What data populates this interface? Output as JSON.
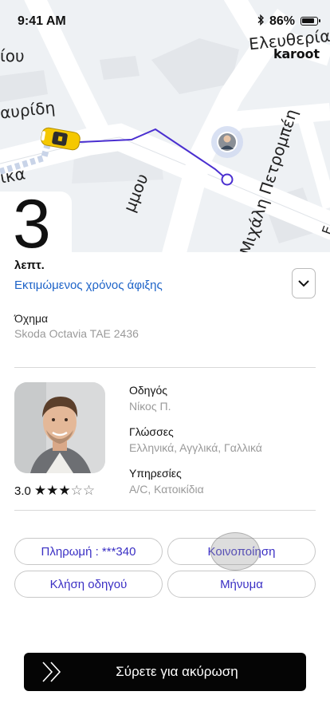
{
  "status_bar": {
    "time": "9:41 AM",
    "battery_percent": "86%",
    "battery_level": 0.86
  },
  "map": {
    "brand": "karoot",
    "streets": [
      "Ελευθερία",
      "ίου",
      "αυρίδη",
      "ικα",
      "μμου",
      "Μιχάλη Πετρομπέη",
      "Ε"
    ]
  },
  "eta": {
    "minutes": "3",
    "unit": "λεπτ.",
    "label": "Εκτιμώμενος χρόνος άφιξης"
  },
  "vehicle": {
    "title": "Όχημα",
    "value": "Skoda Octavia TAE 2436"
  },
  "driver": {
    "rating": "3.0",
    "rating_value": 3,
    "rating_max": 5,
    "driver_title": "Οδηγός",
    "driver_name": "Νίκος Π.",
    "languages_title": "Γλώσσες",
    "languages": "Ελληνικά, Αγγλικά, Γαλλικά",
    "services_title": "Υπηρεσίες",
    "services": "A/C, Κατοικίδια"
  },
  "actions": {
    "payment": "Πληρωμή : ***340",
    "share": "Κοινοποίηση",
    "call": "Κλήση οδηγού",
    "message": "Μήνυμα"
  },
  "slide_to_cancel": "Σύρετε για ακύρωση",
  "colors": {
    "accent_blue": "#1d63c8",
    "button_text": "#3a2fc4",
    "route": "#4a2fd0",
    "taxi": "#f5c800"
  },
  "icons": [
    "bluetooth-icon",
    "battery-icon",
    "chevron-down-icon",
    "taxi-icon",
    "avatar-marker",
    "destination-marker-icon",
    "star-icon",
    "double-chevron-right-icon"
  ]
}
